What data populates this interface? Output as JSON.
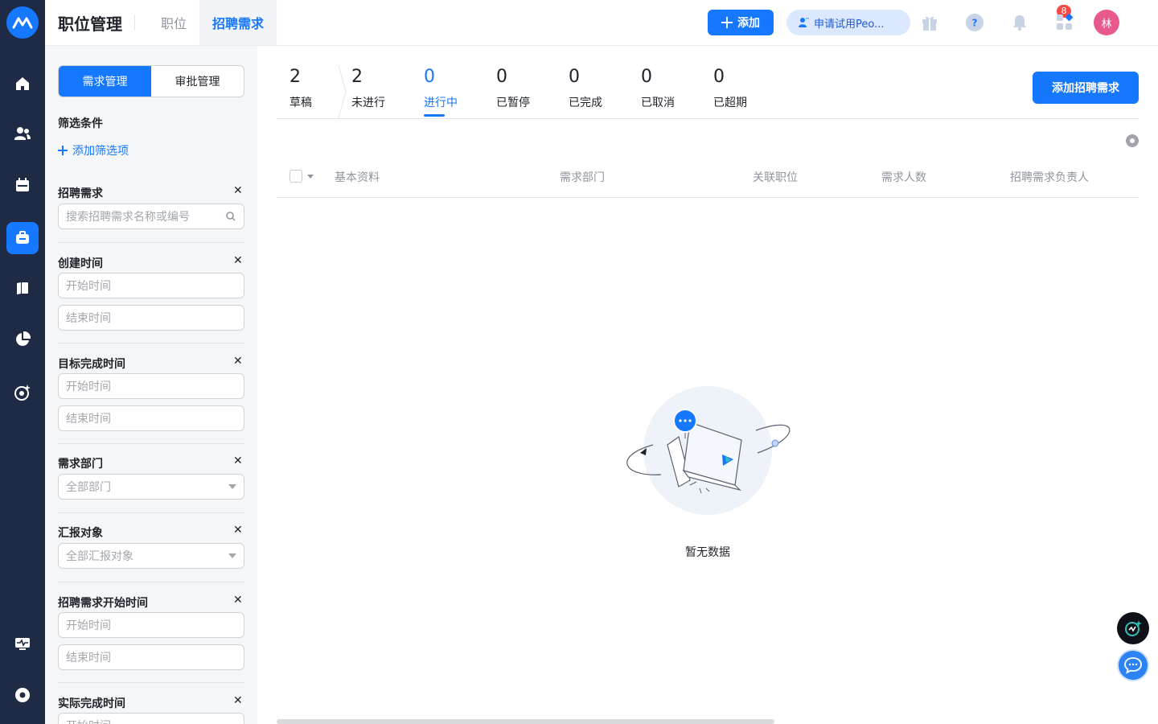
{
  "app": {
    "page_title": "职位管理",
    "tabs": [
      {
        "label": "职位",
        "active": false
      },
      {
        "label": "招聘需求",
        "active": true
      }
    ]
  },
  "header": {
    "add_label": "添加",
    "trial_label": "申请试用Peo...",
    "notification_count": "8",
    "avatar_initial": "林"
  },
  "filters": {
    "segments": [
      {
        "label": "需求管理",
        "active": true
      },
      {
        "label": "审批管理",
        "active": false
      }
    ],
    "heading": "筛选条件",
    "add_filter_label": "添加筛选项",
    "groups": [
      {
        "label": "招聘需求",
        "placeholder": "搜索招聘需求名称或编号"
      },
      {
        "label": "创建时间",
        "start": "开始时间",
        "end": "结束时间"
      },
      {
        "label": "目标完成时间",
        "start": "开始时间",
        "end": "结束时间"
      },
      {
        "label": "需求部门",
        "select": "全部部门"
      },
      {
        "label": "汇报对象",
        "select": "全部汇报对象"
      },
      {
        "label": "招聘需求开始时间",
        "start": "开始时间",
        "end": "结束时间"
      },
      {
        "label": "实际完成时间",
        "start": "开始时间"
      }
    ]
  },
  "status_tabs": [
    {
      "count": "2",
      "label": "草稿"
    },
    {
      "count": "2",
      "label": "未进行"
    },
    {
      "count": "0",
      "label": "进行中",
      "active": true
    },
    {
      "count": "0",
      "label": "已暂停"
    },
    {
      "count": "0",
      "label": "已完成"
    },
    {
      "count": "0",
      "label": "已取消"
    },
    {
      "count": "0",
      "label": "已超期"
    }
  ],
  "main": {
    "add_requirement_label": "添加招聘需求",
    "columns": [
      "基本资料",
      "需求部门",
      "关联职位",
      "需求人数",
      "招聘需求负责人"
    ],
    "empty_text": "暂无数据"
  },
  "colors": {
    "primary": "#1677ff",
    "sidebar": "#1f2a44",
    "badge": "#f54a45",
    "avatar": "#e8598f"
  }
}
